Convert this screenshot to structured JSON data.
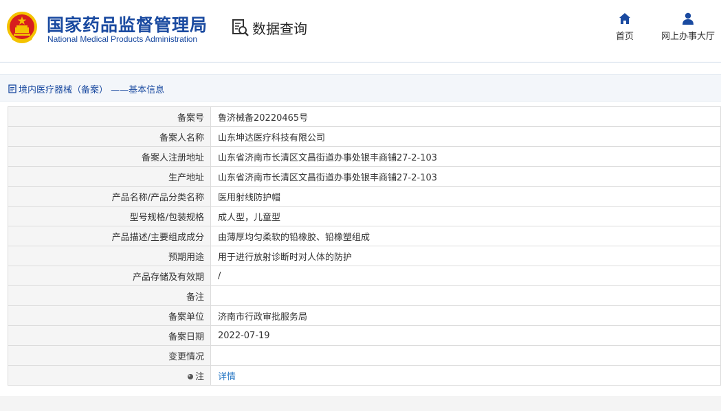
{
  "header": {
    "org_name_cn": "国家药品监督管理局",
    "org_name_en": "National Medical Products Administration",
    "data_query_label": "数据查询",
    "nav": [
      {
        "label": "首页",
        "icon": "home-icon"
      },
      {
        "label": "网上办事大厅",
        "icon": "user-icon"
      }
    ]
  },
  "section": {
    "title": "境内医疗器械（备案） ——基本信息",
    "icon": "document-icon"
  },
  "record": [
    {
      "key": "备案号",
      "value": "鲁济械备20220465号"
    },
    {
      "key": "备案人名称",
      "value": "山东坤达医疗科技有限公司"
    },
    {
      "key": "备案人注册地址",
      "value": "山东省济南市长清区文昌街道办事处银丰商铺27-2-103"
    },
    {
      "key": "生产地址",
      "value": "山东省济南市长清区文昌街道办事处银丰商铺27-2-103"
    },
    {
      "key": "产品名称/产品分类名称",
      "value": "医用射线防护帽"
    },
    {
      "key": "型号规格/包装规格",
      "value": "成人型，儿童型"
    },
    {
      "key": "产品描述/主要组成成分",
      "value": "由薄厚均匀柔软的铅橡胶、铅橡塑组成"
    },
    {
      "key": "预期用途",
      "value": "用于进行放射诊断时对人体的防护"
    },
    {
      "key": "产品存储及有效期",
      "value": "/"
    },
    {
      "key": "备注",
      "value": ""
    },
    {
      "key": "备案单位",
      "value": "济南市行政审批服务局"
    },
    {
      "key": "备案日期",
      "value": "2022-07-19"
    },
    {
      "key": "变更情况",
      "value": ""
    },
    {
      "key": "注",
      "value": "详情",
      "link": true
    }
  ],
  "colors": {
    "brand_blue": "#1a4aa0",
    "link_blue": "#2a79c5",
    "emblem_red": "#d71e1e",
    "emblem_gold": "#f4c300"
  }
}
